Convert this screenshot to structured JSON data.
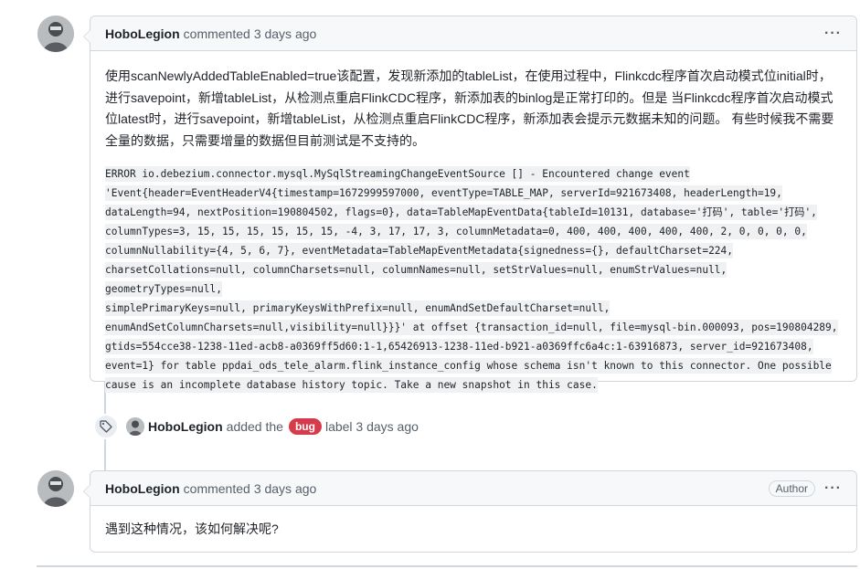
{
  "comment1": {
    "author": "HoboLegion",
    "verb": "commented",
    "time": "3 days ago",
    "menu": "···",
    "paragraph": "使用scanNewlyAddedTableEnabled=true该配置，发现新添加的tableList，在使用过程中，Flinkcdc程序首次启动模式位initial时，进行savepoint，新增tableList，从检测点重启FlinkCDC程序，新添加表的binlog是正常打印的。但是 当Flinkcdc程序首次启动模式位latest时，进行savepoint，新增tableList，从检测点重启FlinkCDC程序，新添加表会提示元数据未知的问题。 有些时候我不需要全量的数据，只需要增量的数据但目前测试是不支持的。",
    "code_lines": [
      " ERROR io.debezium.connector.mysql.MySqlStreamingChangeEventSource  [] - Encountered change event ",
      "'Event{header=EventHeaderV4{timestamp=1672999597000, eventType=TABLE_MAP, serverId=921673408, headerLength=19,",
      "dataLength=94, nextPosition=190804502, flags=0}, data=TableMapEventData{tableId=10131, database='打码', table='打码',",
      "columnTypes=3, 15, 15, 15, 15, 15, 15, -4, 3, 17, 17, 3, columnMetadata=0, 400, 400, 400, 400, 400, 2, 0, 0, 0, 0,",
      "columnNullability={4, 5, 6, 7}, eventMetadata=TableMapEventMetadata{signedness={}, defaultCharset=224,",
      "charsetCollations=null, columnCharsets=null, columnNames=null, setStrValues=null, enumStrValues=null, geometryTypes=null,",
      "simplePrimaryKeys=null, primaryKeysWithPrefix=null, enumAndSetDefaultCharset=null,",
      "enumAndSetColumnCharsets=null,visibility=null}}}' at offset {transaction_id=null, file=mysql-bin.000093, pos=190804289,",
      "gtids=554cce38-1238-11ed-acb8-a0369ff5d60:1-1,65426913-1238-11ed-b921-a0369ffc6a4c:1-63916873, server_id=921673408,",
      "event=1} for table ppdai_ods_tele_alarm.flink_instance_config whose schema isn't known to this connector. One possible",
      "cause is an incomplete database history topic. Take a new snapshot in this case."
    ]
  },
  "label_event": {
    "author": "HoboLegion",
    "text_before": "added the",
    "label": "bug",
    "label_color": "#d73a4a",
    "text_after": "label 3 days ago",
    "icon": "tag-icon"
  },
  "comment2": {
    "author": "HoboLegion",
    "verb": "commented",
    "time": "3 days ago",
    "badge": "Author",
    "menu": "···",
    "body": "遇到这种情况，该如何解决呢?"
  }
}
